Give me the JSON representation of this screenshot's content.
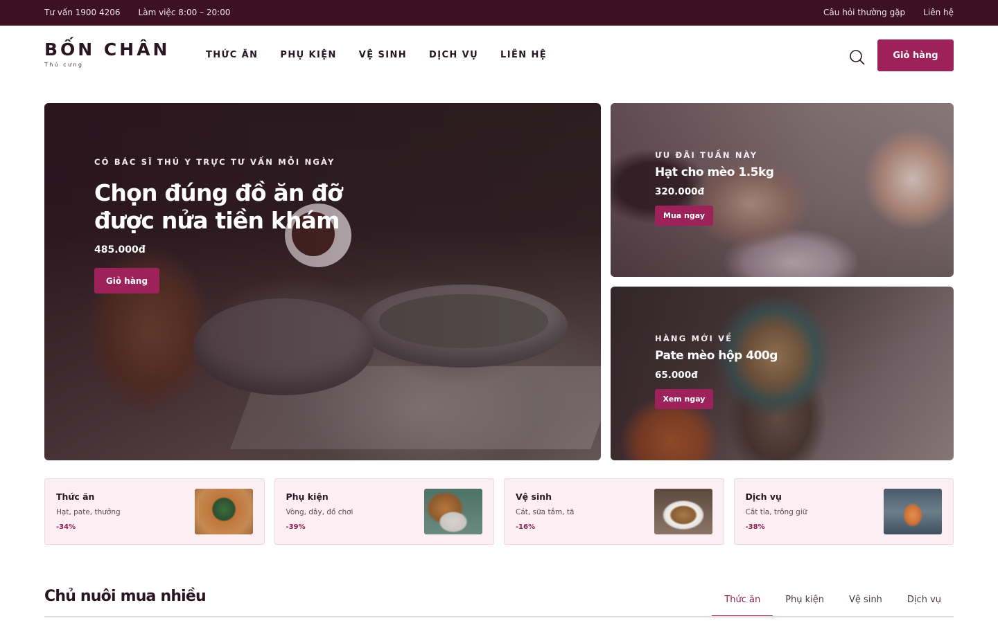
{
  "topbar": {
    "hotline": "Tư vấn 1900 4206",
    "hours": "Làm việc 8:00 – 20:00",
    "faq": "Câu hỏi thường gặp",
    "contact": "Liên hệ"
  },
  "header": {
    "brand": "BỐN CHÂN",
    "tagline": "Thú cưng",
    "nav": [
      "THỨC ĂN",
      "PHỤ KIỆN",
      "VỆ SINH",
      "DỊCH VỤ",
      "LIÊN HỆ"
    ],
    "cart_label": "Giỏ hàng",
    "search_icon": "search-icon"
  },
  "hero_main": {
    "eyebrow": "CÓ BÁC SĨ THÚ Y TRỰC TƯ VẤN MỖI NGÀY",
    "title": "Chọn đúng đồ ăn đỡ được nửa tiền khám",
    "price": "485.000đ",
    "button": "Giỏ hàng"
  },
  "hero_side": [
    {
      "eyebrow": "ƯU ĐÃI TUẦN NÀY",
      "title": "Hạt cho mèo 1.5kg",
      "price": "320.000đ",
      "button": "Mua ngay"
    },
    {
      "eyebrow": "HÀNG MỚI VỀ",
      "title": "Pate mèo hộp 400g",
      "price": "65.000đ",
      "button": "Xem ngay"
    }
  ],
  "categories": [
    {
      "title": "Thức ăn",
      "desc": "Hạt, pate, thưởng",
      "discount": "-34%"
    },
    {
      "title": "Phụ kiện",
      "desc": "Vòng, dây, đồ chơi",
      "discount": "-39%"
    },
    {
      "title": "Vệ sinh",
      "desc": "Cát, sữa tắm, tã",
      "discount": "-16%"
    },
    {
      "title": "Dịch vụ",
      "desc": "Cắt tỉa, trông giữ",
      "discount": "-38%"
    }
  ],
  "best_sellers": {
    "title": "Chủ nuôi mua nhiều",
    "tabs": [
      "Thức ăn",
      "Phụ kiện",
      "Vệ sinh",
      "Dịch vụ"
    ],
    "active_tab": "Thức ăn"
  },
  "colors": {
    "topbar": "#3d1122",
    "accent": "#9c2259",
    "card_bg": "#fbeff3"
  }
}
